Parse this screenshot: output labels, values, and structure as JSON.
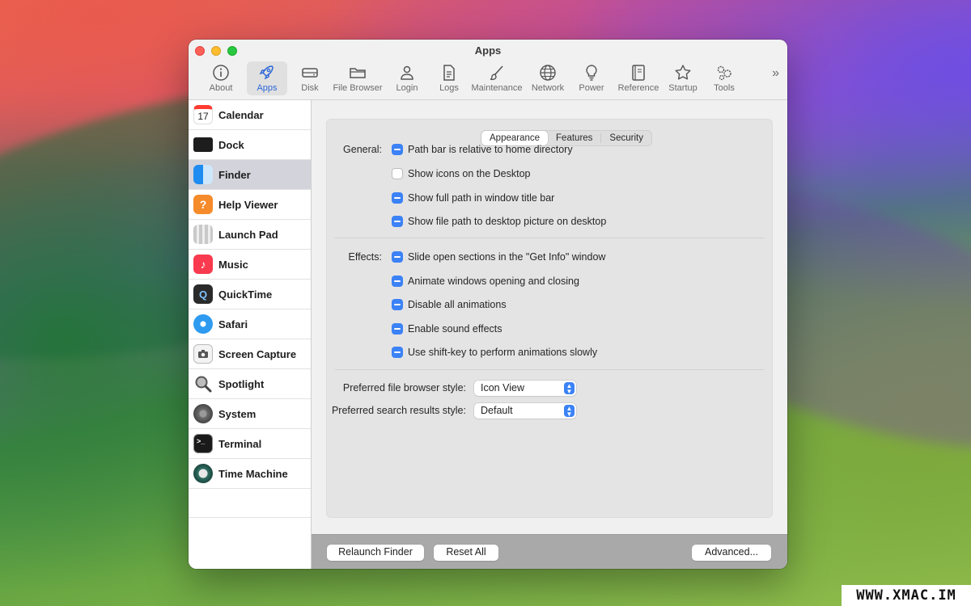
{
  "window": {
    "title": "Apps"
  },
  "toolbar": {
    "items": [
      {
        "label": "About",
        "icon": "info-icon"
      },
      {
        "label": "Apps",
        "icon": "rocket-icon",
        "active": true
      },
      {
        "label": "Disk",
        "icon": "disk-icon"
      },
      {
        "label": "File Browser",
        "icon": "folder-icon"
      },
      {
        "label": "Login",
        "icon": "person-icon"
      },
      {
        "label": "Logs",
        "icon": "document-icon"
      },
      {
        "label": "Maintenance",
        "icon": "brush-icon"
      },
      {
        "label": "Network",
        "icon": "globe-icon"
      },
      {
        "label": "Power",
        "icon": "lightbulb-icon"
      },
      {
        "label": "Reference",
        "icon": "book-icon"
      },
      {
        "label": "Startup",
        "icon": "star-icon"
      },
      {
        "label": "Tools",
        "icon": "gears-icon"
      }
    ],
    "more": "»"
  },
  "sidebar": {
    "items": [
      {
        "label": "Calendar",
        "icon": "calendar-icon",
        "icon_text": "17"
      },
      {
        "label": "Dock",
        "icon": "dock-icon"
      },
      {
        "label": "Finder",
        "icon": "finder-icon",
        "selected": true
      },
      {
        "label": "Help Viewer",
        "icon": "help-icon",
        "icon_text": "?"
      },
      {
        "label": "Launch Pad",
        "icon": "launchpad-icon"
      },
      {
        "label": "Music",
        "icon": "music-icon",
        "icon_text": "♪"
      },
      {
        "label": "QuickTime",
        "icon": "quicktime-icon",
        "icon_text": "Q"
      },
      {
        "label": "Safari",
        "icon": "safari-icon"
      },
      {
        "label": "Screen Capture",
        "icon": "camera-icon"
      },
      {
        "label": "Spotlight",
        "icon": "magnifier-icon"
      },
      {
        "label": "System",
        "icon": "system-icon"
      },
      {
        "label": "Terminal",
        "icon": "terminal-icon",
        "icon_text": ">_"
      },
      {
        "label": "Time Machine",
        "icon": "time-machine-icon"
      }
    ]
  },
  "tabs": [
    {
      "label": "Appearance",
      "active": true
    },
    {
      "label": "Features"
    },
    {
      "label": "Security"
    }
  ],
  "general": {
    "label": "General:",
    "options": [
      {
        "label": "Path bar is relative to home directory",
        "state": "mixed"
      },
      {
        "label": "Show icons on the Desktop",
        "state": "off"
      },
      {
        "label": "Show full path in window title bar",
        "state": "mixed"
      },
      {
        "label": "Show file path to desktop picture on desktop",
        "state": "mixed"
      }
    ]
  },
  "effects": {
    "label": "Effects:",
    "options": [
      {
        "label": "Slide open sections in the \"Get Info\" window",
        "state": "mixed"
      },
      {
        "label": "Animate windows opening and closing",
        "state": "mixed"
      },
      {
        "label": "Disable all animations",
        "state": "mixed"
      },
      {
        "label": "Enable sound effects",
        "state": "mixed"
      },
      {
        "label": "Use shift-key to perform animations slowly",
        "state": "mixed"
      }
    ]
  },
  "prefs": {
    "file_browser_label": "Preferred file browser style:",
    "file_browser_value": "Icon View",
    "search_label": "Preferred search results style:",
    "search_value": "Default"
  },
  "footer": {
    "relaunch": "Relaunch Finder",
    "reset": "Reset All",
    "advanced": "Advanced..."
  },
  "watermark": "WWW.XMAC.IM",
  "colors": {
    "accent": "#3b82f6",
    "active_tab_text": "#2c67d8"
  }
}
